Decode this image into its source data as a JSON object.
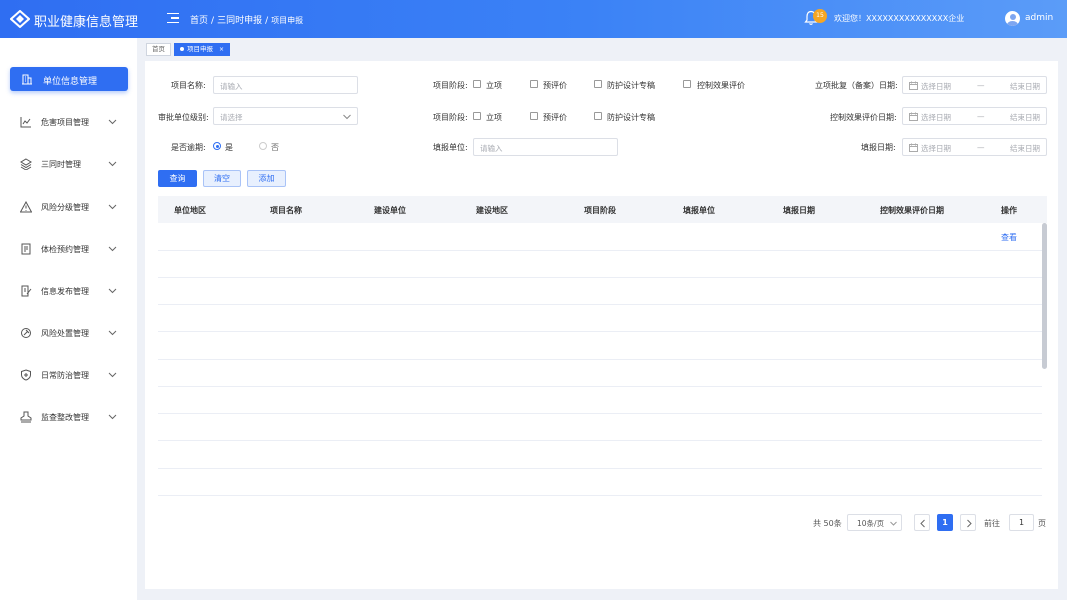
{
  "header": {
    "title": "职业健康信息管理",
    "breadcrumb": [
      "首页",
      "三同时申报",
      "项目申报"
    ],
    "notification_count": "15",
    "welcome": "欢迎您！XXXXXXXXXXXXXXX企业",
    "username": "admin"
  },
  "sidebar": {
    "items": [
      {
        "label": "单位信息管理",
        "icon": "building-icon",
        "active": true
      },
      {
        "label": "危害项目管理",
        "icon": "chart-line-icon"
      },
      {
        "label": "三同时管理",
        "icon": "layers-icon"
      },
      {
        "label": "风险分级管理",
        "icon": "warning-icon"
      },
      {
        "label": "体检预约管理",
        "icon": "clipboard-icon"
      },
      {
        "label": "信息发布管理",
        "icon": "edit-doc-icon"
      },
      {
        "label": "风险处置管理",
        "icon": "tool-icon"
      },
      {
        "label": "日常防治管理",
        "icon": "shield-plus-icon"
      },
      {
        "label": "监查整改管理",
        "icon": "stamp-icon"
      }
    ]
  },
  "tabs": [
    {
      "label": "首页"
    },
    {
      "label": "项目申报",
      "close": "×"
    }
  ],
  "filters": {
    "project_name_label": "项目名称:",
    "project_name_placeholder": "请输入",
    "stage_label_1": "项目阶段:",
    "stage_label_2": "项目阶段:",
    "stage_options": [
      "立项",
      "预评价",
      "防护设计专稿",
      "控制效果评价"
    ],
    "approval_date_label": "立项批复（备案）日期:",
    "approval_level_label": "审批单位级别:",
    "approval_level_placeholder": "请选择",
    "control_date_label": "控制效果评价日期:",
    "overdue_label": "是否逾期:",
    "overdue_yes": "是",
    "overdue_no": "否",
    "report_unit_label": "填报单位:",
    "report_unit_placeholder": "请输入",
    "report_date_label": "填报日期:",
    "date_start_placeholder": "选择日期",
    "date_separator": "—",
    "date_end_placeholder": "结束日期"
  },
  "buttons": {
    "query": "查询",
    "clear": "清空",
    "add": "添加"
  },
  "table": {
    "columns": [
      "单位地区",
      "项目名称",
      "建设单位",
      "建设地区",
      "项目阶段",
      "填报单位",
      "填报日期",
      "控制效果评价日期",
      "操作"
    ],
    "rows": [
      {
        "action": "查看"
      }
    ]
  },
  "pagination": {
    "total": "共 50条",
    "page_size": "10条/页",
    "current_page": "1",
    "goto_label": "前往",
    "goto_value": "1",
    "page_suffix": "页"
  },
  "colors": {
    "primary": "#2f6ef2",
    "badge": "#f6a623"
  }
}
